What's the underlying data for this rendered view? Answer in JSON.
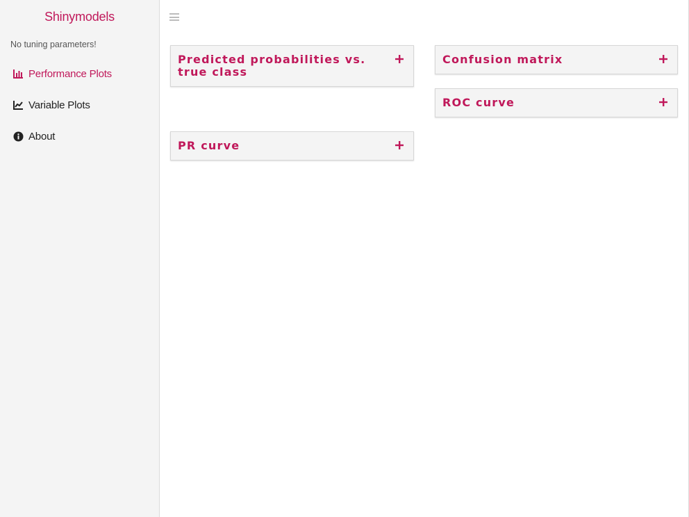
{
  "sidebar": {
    "brand": "Shinymodels",
    "tuning_note": "No tuning parameters!",
    "items": [
      {
        "label": "Performance Plots",
        "icon": "bar-chart-icon",
        "active": true
      },
      {
        "label": "Variable Plots",
        "icon": "line-chart-icon",
        "active": false
      },
      {
        "label": "About",
        "icon": "info-circle-icon",
        "active": false
      }
    ]
  },
  "header": {
    "toggle_icon": "hamburger-menu-icon"
  },
  "main": {
    "boxes": [
      {
        "title": "Predicted probabilities vs. true class",
        "tool_icon": "plus-icon",
        "collapsed": true
      },
      {
        "title": "Confusion matrix",
        "tool_icon": "plus-icon",
        "collapsed": true
      },
      {
        "title": "ROC curve",
        "tool_icon": "plus-icon",
        "collapsed": true
      },
      {
        "title": "PR curve",
        "tool_icon": "plus-icon",
        "collapsed": true
      }
    ]
  },
  "colors": {
    "accent": "#c0185a",
    "sidebar_bg": "#f4f4f4",
    "box_bg": "#f4f4f4",
    "text_dark": "#222222"
  }
}
